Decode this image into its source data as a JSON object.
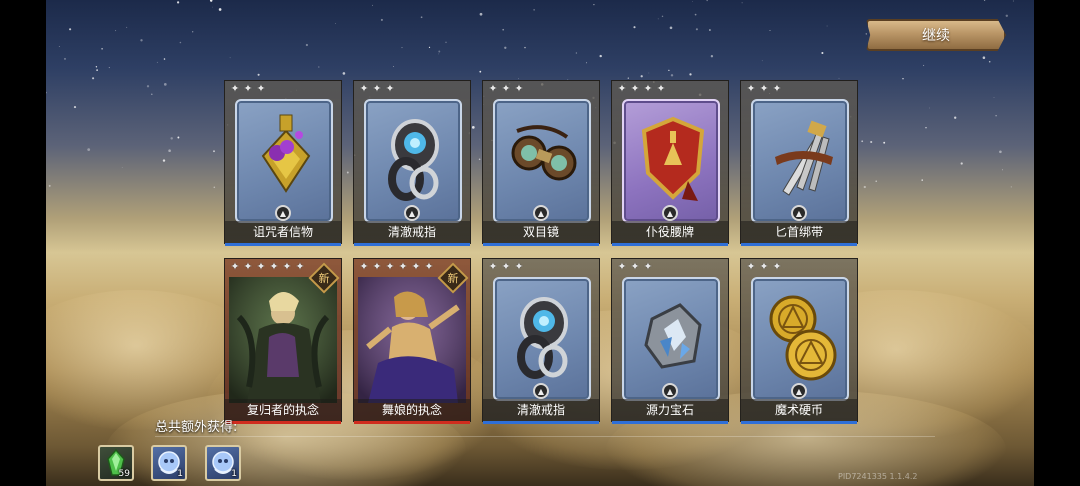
{
  "continue_button": "继续",
  "cards": [
    {
      "name": "诅咒者信物",
      "stars": 3,
      "inner": "blue",
      "art": "cursed-token-icon",
      "new": false
    },
    {
      "name": "清澈戒指",
      "stars": 3,
      "inner": "blue",
      "art": "clear-ring-icon",
      "new": false
    },
    {
      "name": "双目镜",
      "stars": 3,
      "inner": "blue",
      "art": "binoculars-icon",
      "new": false
    },
    {
      "name": "仆役腰牌",
      "stars": 4,
      "inner": "purple",
      "art": "servant-badge-icon",
      "new": false
    },
    {
      "name": "匕首绑带",
      "stars": 3,
      "inner": "blue",
      "art": "dagger-strap-icon",
      "new": false
    },
    {
      "name": "复归者的执念",
      "stars": 6,
      "inner": "portrait",
      "art": "revenant-portrait",
      "new": true
    },
    {
      "name": "舞娘的执念",
      "stars": 6,
      "inner": "portrait",
      "art": "dancer-portrait",
      "new": true
    },
    {
      "name": "清澈戒指",
      "stars": 3,
      "inner": "blue",
      "art": "clear-ring-icon",
      "new": false
    },
    {
      "name": "源力宝石",
      "stars": 3,
      "inner": "blue",
      "art": "source-gem-icon",
      "new": false
    },
    {
      "name": "魔术硬币",
      "stars": 3,
      "inner": "blue",
      "art": "magic-coin-icon",
      "new": false
    }
  ],
  "new_badge": "新",
  "extra_rewards_label": "总共额外获得:",
  "extra_rewards": [
    {
      "icon": "green-crystal-icon",
      "count": "59"
    },
    {
      "icon": "blue-spirit-icon",
      "count": "1"
    },
    {
      "icon": "blue-spirit-icon",
      "count": "1"
    }
  ],
  "version_text": "PID7241335 1.1.4.2"
}
